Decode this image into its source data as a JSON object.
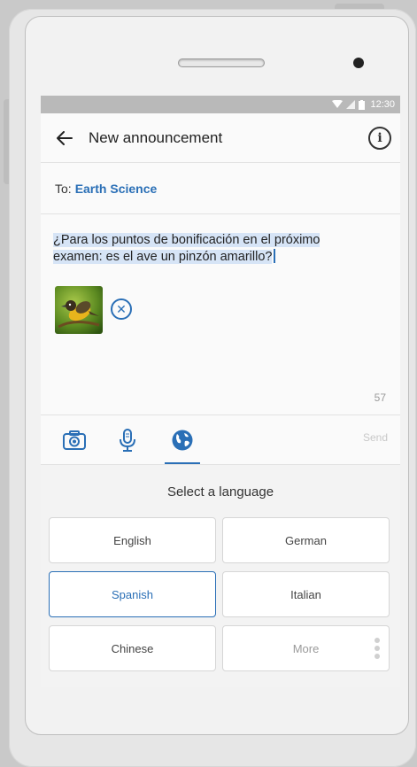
{
  "status_bar": {
    "time": "12:30"
  },
  "app_bar": {
    "title": "New announcement"
  },
  "recipient": {
    "label": "To:",
    "value": "Earth Science"
  },
  "message": {
    "line1": "¿Para los puntos de bonificación en el próximo",
    "line2": "examen: es el ave un pinzón amarillo?",
    "char_count": "57"
  },
  "toolbar": {
    "send_label": "Send",
    "active_tool": "globe"
  },
  "language_panel": {
    "title": "Select a language",
    "options": [
      {
        "label": "English",
        "selected": false
      },
      {
        "label": "German",
        "selected": false
      },
      {
        "label": "Spanish",
        "selected": true
      },
      {
        "label": "Italian",
        "selected": false
      },
      {
        "label": "Chinese",
        "selected": false
      },
      {
        "label": "More",
        "selected": false
      }
    ]
  },
  "colors": {
    "accent": "#2a6fb6",
    "status_bar": "#b9b9b9"
  },
  "icons": [
    "back-arrow-icon",
    "info-icon",
    "camera-icon",
    "microphone-icon",
    "globe-icon",
    "close-circle-icon",
    "wifi-icon",
    "signal-icon",
    "battery-icon"
  ]
}
